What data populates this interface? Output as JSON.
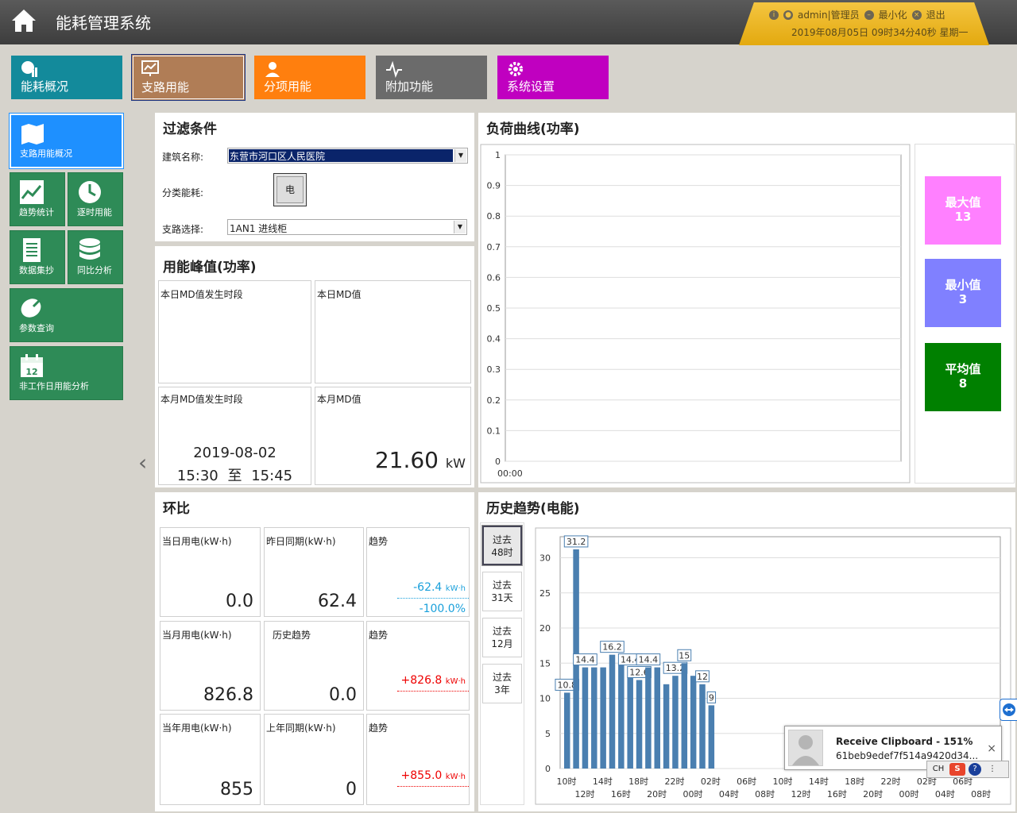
{
  "header": {
    "title": "能耗管理系统",
    "user": "admin|管理员",
    "minimize": "最小化",
    "logout": "退出",
    "datetime": "2019年08月05日 09时34分40秒 星期一"
  },
  "topnav": [
    {
      "label": "能耗概况",
      "color": "#138a9b"
    },
    {
      "label": "支路用能",
      "color": "#b07d56"
    },
    {
      "label": "分项用能",
      "color": "#ff7f0e"
    },
    {
      "label": "附加功能",
      "color": "#6b6b6b"
    },
    {
      "label": "系统设置",
      "color": "#c000c0"
    }
  ],
  "sidenav": [
    {
      "label": "支路用能概况"
    },
    {
      "label": "趋势统计"
    },
    {
      "label": "逐时用能"
    },
    {
      "label": "数据集抄"
    },
    {
      "label": "同比分析"
    },
    {
      "label": "参数查询"
    },
    {
      "label": "非工作日用能分析"
    }
  ],
  "filter": {
    "title": "过滤条件",
    "building_label": "建筑名称:",
    "building_value": "东营市河口区人民医院",
    "category_label": "分类能耗:",
    "category_value": "电",
    "branch_label": "支路选择:",
    "branch_value": "1AN1 进线柜"
  },
  "peak": {
    "title": "用能峰值(功率)",
    "day_period_label": "本日MD值发生时段",
    "day_md_label": "本日MD值",
    "month_period_label": "本月MD值发生时段",
    "month_md_label": "本月MD值",
    "month_date": "2019-08-02",
    "month_time_from": "15:30",
    "month_time_to_label": "至",
    "month_time_to": "15:45",
    "month_md_value": "21.60",
    "month_md_unit": "kW"
  },
  "load_curve": {
    "title": "负荷曲线(功率)",
    "y_ticks": [
      "1",
      "0.9",
      "0.8",
      "0.7",
      "0.6",
      "0.5",
      "0.4",
      "0.3",
      "0.2",
      "0.1",
      "0"
    ],
    "x_label": "00:00",
    "max_label": "最大值",
    "max_value": "13",
    "max_color": "#ff80ff",
    "min_label": "最小值",
    "min_value": "3",
    "min_color": "#8080ff",
    "avg_label": "平均值",
    "avg_value": "8",
    "avg_color": "#008000"
  },
  "ring": {
    "title": "环比",
    "today_label": "当日用电(kW·h)",
    "today_value": "0.0",
    "yday_label": "昨日同期(kW·h)",
    "yday_value": "62.4",
    "trend_label": "趋势",
    "trend1_value": "-62.4",
    "trend1_unit": "kW·h",
    "trend1_pct": "-100.0%",
    "month_label": "当月用电(kW·h)",
    "month_value": "826.8",
    "hist_label": "历史趋势",
    "hist_value": "0.0",
    "trend2_value": "+826.8",
    "trend2_unit": "kW·h",
    "year_label": "当年用电(kW·h)",
    "year_value": "855",
    "lastyear_label": "上年同期(kW·h)",
    "lastyear_value": "0",
    "trend3_value": "+855.0",
    "trend3_unit": "kW·h"
  },
  "history": {
    "title": "历史趋势(电能)",
    "ranges": [
      {
        "line1": "过去",
        "line2": "48时"
      },
      {
        "line1": "过去",
        "line2": "31天"
      },
      {
        "line1": "过去",
        "line2": "12月"
      },
      {
        "line1": "过去",
        "line2": "3年"
      }
    ]
  },
  "chart_data": {
    "type": "bar",
    "y_ticks": [
      0,
      5,
      10,
      15,
      20,
      25,
      30
    ],
    "ylim": [
      0,
      33
    ],
    "x_ticks_top": [
      "10时",
      "14时",
      "18时",
      "22时",
      "02时",
      "06时",
      "10时",
      "14时",
      "18时",
      "22时",
      "02时",
      "06时"
    ],
    "x_ticks_bottom": [
      "12时",
      "16时",
      "20时",
      "00时",
      "04时",
      "08时",
      "12时",
      "16时",
      "20时",
      "00时",
      "04时",
      "08时"
    ],
    "values": [
      10.8,
      31.2,
      14.4,
      14.4,
      14.4,
      16.2,
      15.0,
      14.4,
      12.6,
      14.4,
      14.4,
      12.0,
      13.2,
      15.0,
      13.2,
      12.0,
      9.0
    ],
    "labels": {
      "0": "10.8",
      "1": "31.2",
      "2": "14.4",
      "5": "16.2",
      "7": "14.4",
      "8": "12.6",
      "9": "14.4",
      "12": "13.2",
      "13": "15",
      "15": "12",
      "16": "9"
    },
    "bar_color": "#4a7fb0"
  },
  "popup": {
    "title": "Receive Clipboard - 151%",
    "subtitle": "61beb9edef7f514a9420d34...",
    "close": "×",
    "tray_ime": "CH"
  }
}
